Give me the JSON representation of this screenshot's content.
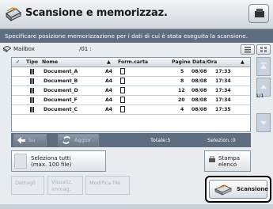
{
  "title": "Scansione e memorizzaz.",
  "instruction": "Specificare posizione memorizzazione per i dati di cui è stata eseguita la scansione.",
  "mailbox": {
    "label": "Mailbox",
    "count": "/01 :"
  },
  "table": {
    "headers": {
      "check": "✓",
      "tipo": "Tipo",
      "nome": "Nome",
      "sort": "▲",
      "formato": "Form.carta",
      "pagine": "Pagine",
      "data": "Data/Ora",
      "sort2": "▲"
    },
    "rows": [
      {
        "name": "Document_A",
        "size": "A4",
        "pages": "5",
        "date": "08/08",
        "time": "17:33"
      },
      {
        "name": "Document_B",
        "size": "A4",
        "pages": "8",
        "date": "08/08",
        "time": "17:34"
      },
      {
        "name": "Document_D",
        "size": "A4",
        "pages": "12",
        "date": "08/08",
        "time": "17:34"
      },
      {
        "name": "Document_F",
        "size": "A4",
        "pages": "20",
        "date": "08/08",
        "time": "17:34"
      },
      {
        "name": "Document_C",
        "size": "A4",
        "pages": "4",
        "date": "08/08",
        "time": "17:35"
      }
    ]
  },
  "page_indicator": "1/1",
  "nav": {
    "up": "Su",
    "refresh": "Aggior",
    "totale": "Totale:5",
    "selezion": "Selezion.:0"
  },
  "select_all": {
    "line1": "Seleziona tutti",
    "line2": "(max. 100 file)"
  },
  "print_list": {
    "line1": "Stampa",
    "line2": "elenco"
  },
  "buttons": {
    "dettagli": "Dettagli",
    "visualiz1": "Visualiz.",
    "visualiz2": "immag.",
    "modifica": "Modifica file",
    "scan": "Scansione"
  }
}
